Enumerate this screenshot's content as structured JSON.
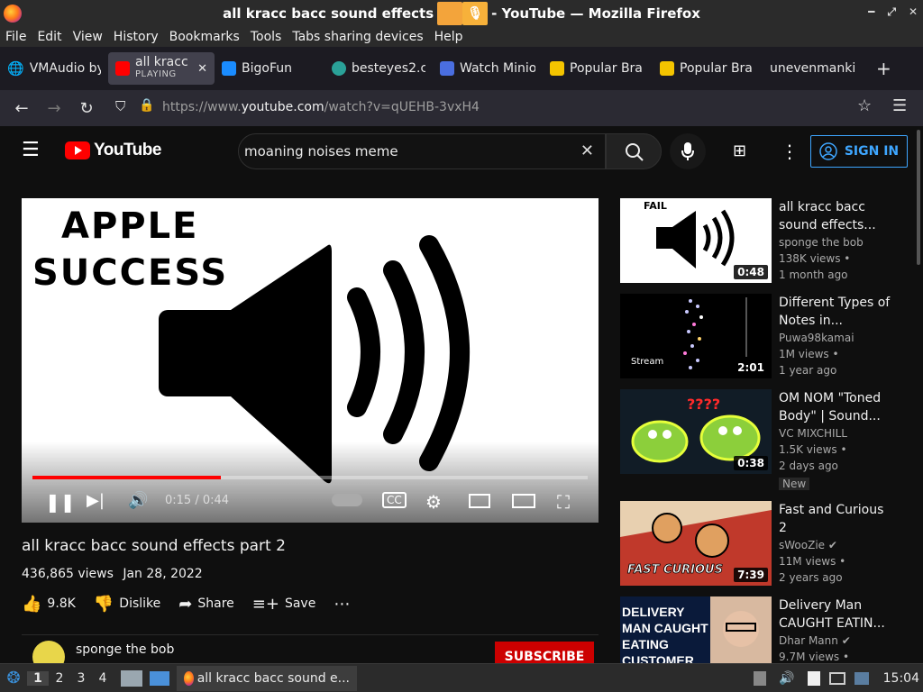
{
  "window": {
    "title_left": "all kracc bacc sound effects",
    "title_right": "- YouTube — Mozilla Firefox"
  },
  "menu": [
    "File",
    "Edit",
    "View",
    "History",
    "Bookmarks",
    "Tools",
    "Tabs sharing devices",
    "Help"
  ],
  "tabs": [
    {
      "label": "VMAudio by",
      "color": "#e8e8e8"
    },
    {
      "label": "all kracc b",
      "sub": "PLAYING",
      "color": "#ff0000"
    },
    {
      "label": "BigoFun",
      "color": "#1a8cff"
    },
    {
      "label": "besteyes2.c",
      "color": "#2aa198"
    },
    {
      "label": "Watch Minio",
      "color": "#4a6ee0"
    },
    {
      "label": "Popular Bra",
      "color": "#f4c400"
    },
    {
      "label": "Popular Bra",
      "color": "#f4c400"
    },
    {
      "label": "unevenmankin",
      "color": "#e8e8e8"
    }
  ],
  "url": {
    "prefix": "https://www.",
    "domain": "youtube.com",
    "path": "/watch?v=qUEHB-3vxH4"
  },
  "youtube": {
    "logo_text": "YouTube",
    "search_value": "moaning noises meme",
    "sign_in": "SIGN IN"
  },
  "player": {
    "thumb_line1": "APPLE",
    "thumb_line2": "SUCCESS",
    "time": "0:15 / 0:44",
    "progress_fraction": 0.34
  },
  "video": {
    "title": "all kracc bacc sound effects part 2",
    "views": "436,865 views",
    "date": "Jan 28, 2022",
    "likes": "9.8K",
    "dislike": "Dislike",
    "share": "Share",
    "save": "Save",
    "channel": "sponge the bob",
    "subscribe": "SUBSCRIBE"
  },
  "recommendations": [
    {
      "title": "all kracc bacc sound effects...",
      "channel": "sponge the bob",
      "views": "138K views •",
      "age": "1 month ago",
      "duration": "0:48",
      "thumb_label": "FAIL"
    },
    {
      "title": "Different Types of Notes in...",
      "channel": "Puwa98kamai",
      "views": "1M views •",
      "age": "1 year ago",
      "duration": "2:01",
      "thumb_label": "Stream"
    },
    {
      "title": "OM NOM \"Toned Body\" | Sound...",
      "channel": "VC MIXCHILL",
      "views": "1.5K views •",
      "age": "2 days ago",
      "duration": "0:38",
      "badge": "New",
      "thumb_label": "????"
    },
    {
      "title": "Fast and Curious 2",
      "channel": "sWooZie",
      "views": "11M views •",
      "age": "2 years ago",
      "duration": "7:39",
      "thumb_label": "FAST CURIOUS"
    },
    {
      "title": "Delivery Man CAUGHT EATIN...",
      "channel": "Dhar Mann",
      "views": "9.7M views •",
      "age": "",
      "duration": "",
      "thumb_label": "DELIVERY MAN CAUGHT EATING CUSTOMER FOOD"
    }
  ],
  "taskbar": {
    "workspaces": [
      "1",
      "2",
      "3",
      "4"
    ],
    "active_task": "all kracc bacc sound e...",
    "clock": "15:04"
  }
}
